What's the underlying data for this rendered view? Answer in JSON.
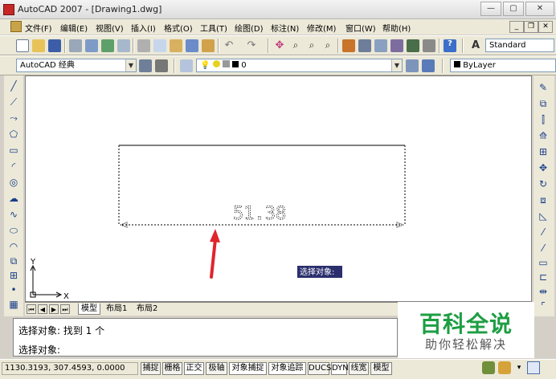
{
  "window": {
    "title": "AutoCAD 2007 - [Drawing1.dwg]"
  },
  "menu": [
    "文件(F)",
    "编辑(E)",
    "视图(V)",
    "插入(I)",
    "格式(O)",
    "工具(T)",
    "绘图(D)",
    "标注(N)",
    "修改(M)",
    "窗口(W)",
    "帮助(H)"
  ],
  "toolbar": {
    "text_style": "Standard",
    "workspace": "AutoCAD 经典",
    "layer": "0",
    "color": "ByLayer"
  },
  "drawing": {
    "dimension_text": "51.38",
    "tooltip": "选择对象:",
    "ucs_x": "X",
    "ucs_y": "Y"
  },
  "tabs": [
    "模型",
    "布局1",
    "布局2"
  ],
  "command": {
    "line1": "选择对象: 找到 1 个",
    "line2": "选择对象:"
  },
  "status": {
    "coords": "1130.3193, 307.4593, 0.0000",
    "buttons": [
      "捕捉",
      "栅格",
      "正交",
      "极轴",
      "对象捕捉",
      "对象追踪",
      "DUCS",
      "DYN",
      "线宽",
      "模型"
    ]
  },
  "watermark": {
    "title": "百科全说",
    "subtitle": "助你轻松解决"
  },
  "colors": {
    "accent_arrow": "#e0242a",
    "watermark_green": "#1d9e43",
    "tooltip_bg": "#2b2f6e"
  }
}
